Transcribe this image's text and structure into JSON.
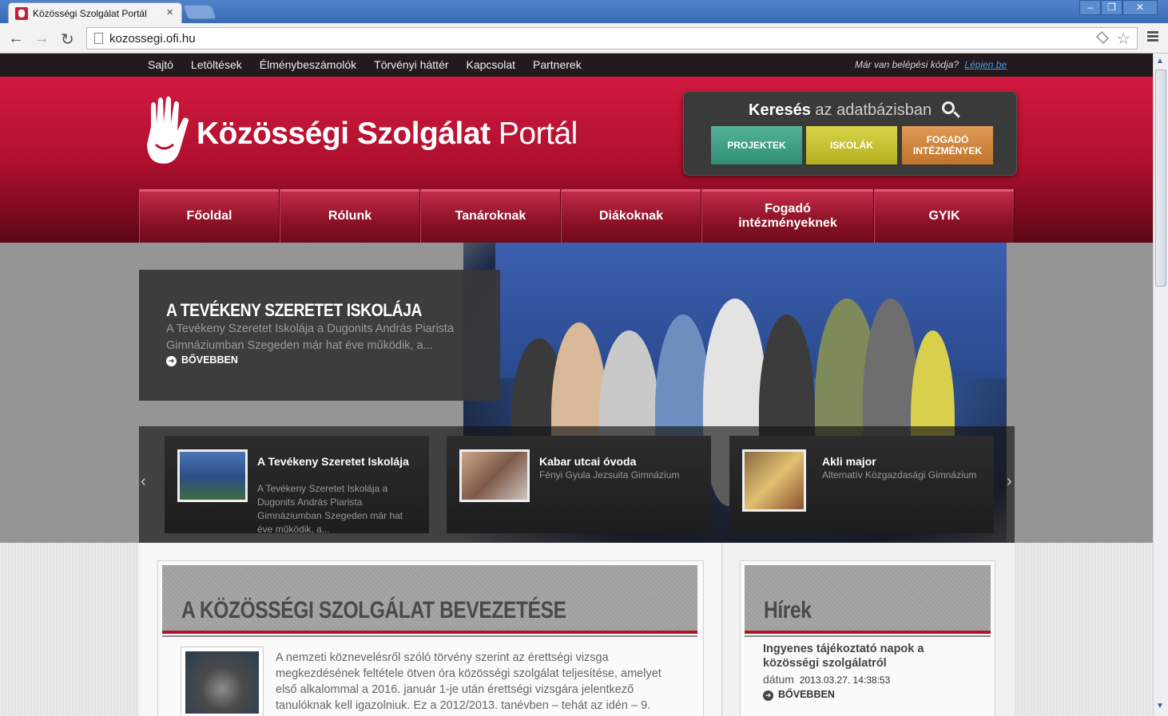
{
  "browser": {
    "tab_title": "Közösségi Szolgálat Portál",
    "tab_close": "×",
    "url": "kozossegi.ofi.hu",
    "win_minimize": "–",
    "win_restore": "❐",
    "win_close": "✕",
    "back": "←",
    "forward": "→",
    "reload": "↻",
    "star": "☆"
  },
  "topnav": {
    "items": [
      "Sajtó",
      "Letöltések",
      "Élménybeszámolók",
      "Törvényi háttér",
      "Kapcsolat",
      "Partnerek"
    ],
    "login_prompt": "Már van belépési kódja?",
    "login_link": "Lépjen be"
  },
  "header": {
    "logo_bold": "Közösségi Szolgálat",
    "logo_light": "Portál",
    "search_title_bold": "Keresés",
    "search_title_rest": "az adatbázisban",
    "buttons": [
      "PROJEKTEK",
      "ISKOLÁK",
      "FOGADÓ INTÉZMÉNYEK"
    ],
    "colors": {
      "projektek": "#3a9c80",
      "iskolak": "#c9c435",
      "fogado": "#d3863f",
      "brand": "#b8102f"
    }
  },
  "mainnav": [
    "Főoldal",
    "Rólunk",
    "Tanároknak",
    "Diákoknak",
    "Fogadó intézményeknek",
    "GYIK"
  ],
  "slider": {
    "caption_title": "A TEVÉKENY SZERETET ISKOLÁJA",
    "caption_desc": "A Tevékeny Szeretet Iskolája a Dugonits András Piarista Gimnáziumban Szegeden már hat éve működik, a...",
    "caption_more": "BŐVEBBEN",
    "prev": "‹",
    "next": "›",
    "cards": [
      {
        "title": "A Tevékeny Szeretet Iskolája",
        "desc": "A Tevékeny Szeretet Iskolája a Dugonits András Piarista Gimnáziumban Szegeden már hat éve működik, a..."
      },
      {
        "title": "Kabar utcai óvoda",
        "desc": "Fényi Gyula Jezsuita Gimnázium"
      },
      {
        "title": "Akli major",
        "desc": "Alternatív Közgazdasági Gimnázium"
      }
    ]
  },
  "intro": {
    "heading": "A KÖZÖSSÉGI SZOLGÁLAT BEVEZETÉSE",
    "text": "A nemzeti köznevelésről szóló törvény szerint az érettségi vizsga megkezdésének feltétele ötven óra közösségi szolgálat teljesítése, amelyet első alkalommal a 2016. január 1-je után érettségi vizsgára jelentkező tanulóknak kell igazolniuk. Ez a 2012/2013. tanévben – tehát az idén – 9."
  },
  "news": {
    "heading": "Hírek",
    "title": "Ingyenes tájékoztató napok a közösségi szolgálatról",
    "date_label": "dátum",
    "date": "2013.03.27. 14:38:53",
    "more": "BŐVEBBEN"
  }
}
